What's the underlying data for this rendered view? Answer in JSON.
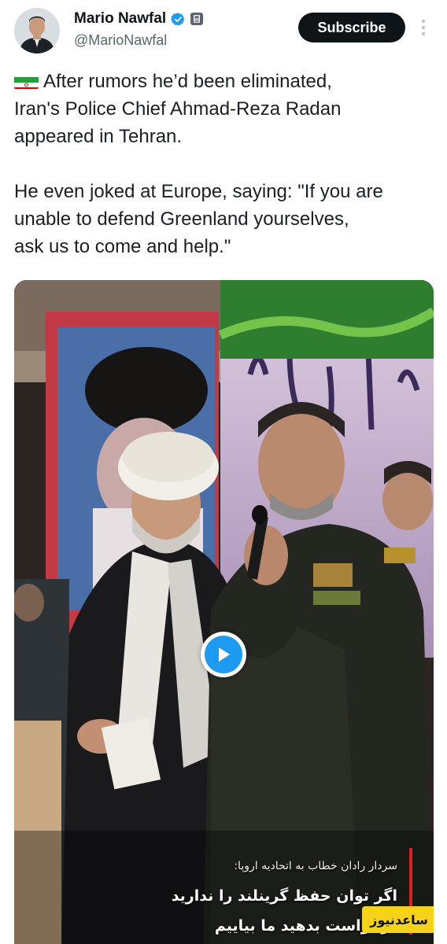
{
  "author": {
    "display_name": "Mario Nawfal",
    "handle": "@MarioNawfal",
    "verified_icon": "verified-badge-icon",
    "affiliate_icon": "affiliate-badge-icon"
  },
  "actions": {
    "subscribe_label": "Subscribe",
    "more_icon": "more-vertical-icon"
  },
  "tweet": {
    "flag_icon": "iran-flag-icon",
    "line1": "After rumors he’d been eliminated,",
    "line2": "Iran's Police Chief Ahmad-Reza Radan",
    "line3": "appeared in Tehran.",
    "line4": "He even joked at Europe, saying: \"If you are",
    "line5": "unable to defend Greenland yourselves,",
    "line6": "ask us to come and help.\""
  },
  "media": {
    "type": "video",
    "play_icon": "play-icon",
    "caption_top": "سردار رادان خطاب به اتحادیه اروپا:",
    "caption_line1": "اگر توان حفظ گرینلند را ندارید",
    "caption_line2": "درخواست بدهید ما بیاییم",
    "watermark": "ساعدنیوز"
  },
  "colors": {
    "accent": "#1d9bf0",
    "button_bg": "#0f1419",
    "handle_text": "#536471",
    "watermark_bg": "#f6d31a"
  }
}
